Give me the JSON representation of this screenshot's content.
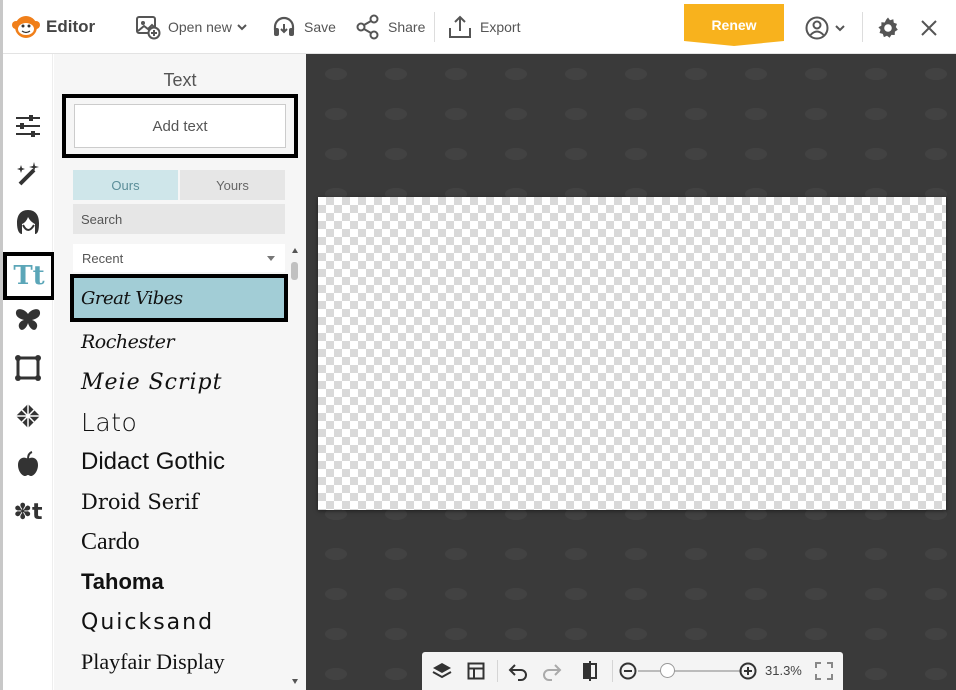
{
  "app": {
    "title": "Editor"
  },
  "toolbar": {
    "open_new": "Open new",
    "save": "Save",
    "share": "Share",
    "export": "Export",
    "renew": "Renew"
  },
  "rail": {
    "items": [
      "adjust-icon",
      "effects-icon",
      "retouch-icon",
      "text-icon",
      "stickers-icon",
      "frames-icon",
      "textures-icon",
      "templates-icon",
      "stock-icon"
    ],
    "active": "text-icon"
  },
  "panel": {
    "title": "Text",
    "add_text": "Add text",
    "tabs": [
      {
        "label": "Ours",
        "active": true
      },
      {
        "label": "Yours",
        "active": false
      }
    ],
    "search_placeholder": "Search",
    "filter_selected": "Recent",
    "fonts": [
      {
        "label": "Great Vibes",
        "selected": true
      },
      {
        "label": "Rochester",
        "selected": false
      },
      {
        "label": "Meie Script",
        "selected": false
      },
      {
        "label": "Lato",
        "selected": false
      },
      {
        "label": "Didact Gothic",
        "selected": false
      },
      {
        "label": "Droid Serif",
        "selected": false
      },
      {
        "label": "Cardo",
        "selected": false
      },
      {
        "label": "Tahoma",
        "selected": false
      },
      {
        "label": "Quicksand",
        "selected": false
      },
      {
        "label": "Playfair Display",
        "selected": false
      }
    ]
  },
  "bottom": {
    "zoom_value": "31.3%",
    "zoom_fraction": 0.28
  },
  "colors": {
    "accent": "#f8b21d",
    "selected_font_bg": "#a2cdd6",
    "workspace": "#3a3a3a",
    "text_icon": "#5ba6b8"
  }
}
